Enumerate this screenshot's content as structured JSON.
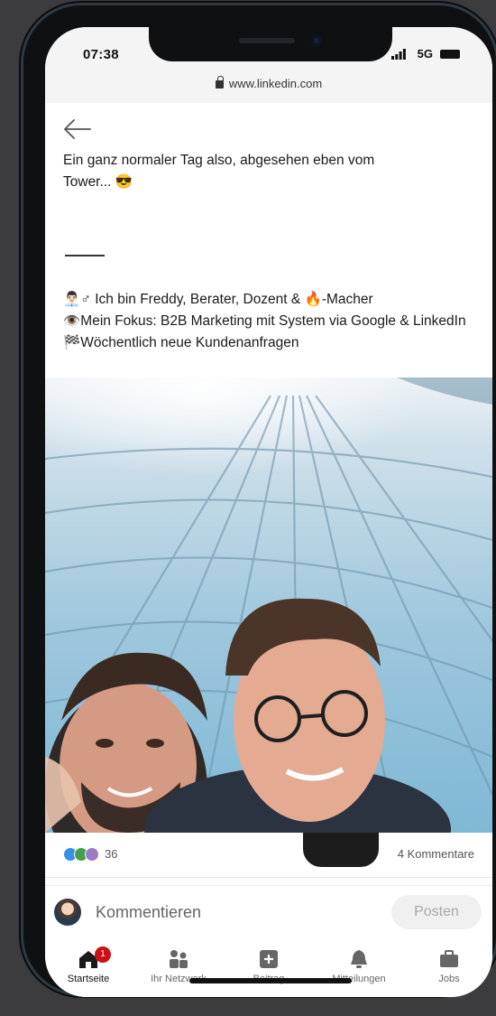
{
  "status_bar": {
    "time": "07:38",
    "network": "5G"
  },
  "browser": {
    "url": "www.linkedin.com"
  },
  "post": {
    "text_partial_line": "Ein ganz normaler Tag also, abgesehen eben vom",
    "text_line2": "Tower... 😎",
    "divider": "____",
    "bio_line1": "👨🏻‍💼♂ Ich bin Freddy, Berater, Dozent & 🔥-Macher",
    "bio_line2": "👁️Mein Fokus: B2B Marketing mit System via Google & LinkedIn",
    "bio_line3": "🏁Wöchentlich neue Kundenanfragen"
  },
  "social": {
    "reaction_count": "36",
    "comment_count": "4 Kommentare"
  },
  "comment_box": {
    "placeholder": "Kommentieren",
    "post_label": "Posten"
  },
  "tabs": [
    {
      "label": "Startseite",
      "badge": "1"
    },
    {
      "label": "Ihr Netzwerk"
    },
    {
      "label": "Beitrag"
    },
    {
      "label": "Mitteilungen"
    },
    {
      "label": "Jobs"
    }
  ],
  "colors": {
    "linkedin_blue": "#0a66c2",
    "badge_red": "#cc1016"
  }
}
